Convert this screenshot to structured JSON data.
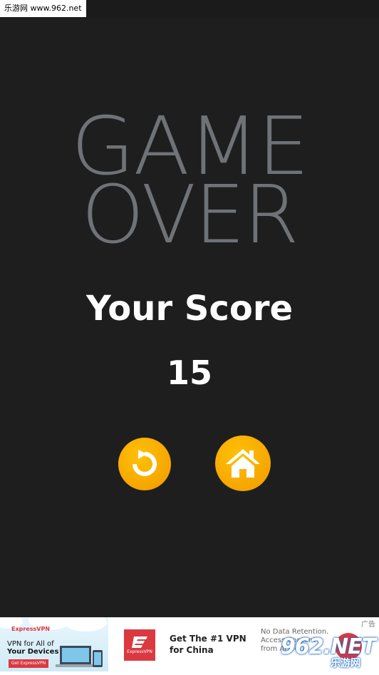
{
  "watermark": {
    "top_left": "乐游网 www.962.net",
    "bottom_right_big": "962.NET",
    "bottom_right_small": "乐游网"
  },
  "game": {
    "title_line1": "GAME",
    "title_line2": "OVER",
    "score_label": "Your Score",
    "score_value": "15"
  },
  "buttons": {
    "restart_icon": "restart-icon",
    "home_icon": "home-icon"
  },
  "colors": {
    "background": "#1e1e1e",
    "title": "#6f7276",
    "button": "#f6a500",
    "ad_red": "#da3940"
  },
  "ad": {
    "brand": "ExpressVPN",
    "left_headline_1": "VPN for All of",
    "left_headline_2": "Your Devices",
    "left_button": "Get ExpressVPN",
    "logo_text": "ExpressVPN",
    "headline": "Get The #1 VPN for China",
    "description": "No Data Retention. Access Content from Ar 24/7",
    "ad_tag": "广告"
  }
}
